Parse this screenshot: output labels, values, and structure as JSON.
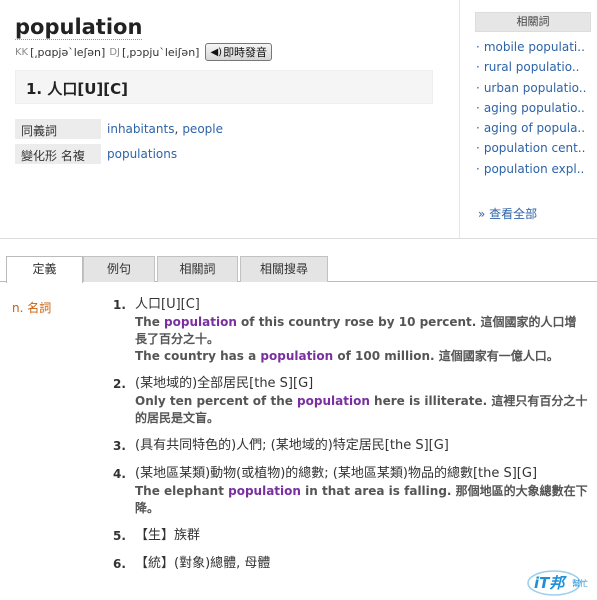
{
  "entry": {
    "word": "population",
    "kk_label": "KK",
    "kk_ipa": "[͵pɑpjə`leʃən]",
    "dj_label": "DJ",
    "dj_ipa": "[͵pɔpju`leiʃən]",
    "speak_label": "即時發音",
    "sense_heading": "1. 人口[U][C]"
  },
  "synonyms": {
    "label": "同義詞",
    "items": [
      "inhabitants",
      "people"
    ]
  },
  "inflections": {
    "label": "變化形 名複",
    "items": [
      "populations"
    ]
  },
  "sidebar": {
    "title": "相關詞",
    "items": [
      "mobile populati..",
      "rural populatio..",
      "urban populatio..",
      "aging populatio..",
      "aging of popula..",
      "population cent..",
      "population expl.."
    ],
    "see_all": "查看全部"
  },
  "tabs": [
    "定義",
    "例句",
    "相關詞",
    "相關搜尋"
  ],
  "definitions": {
    "part_of_speech": "n. 名詞",
    "senses": [
      {
        "num": "1.",
        "text": "人口[U][C]",
        "examples": [
          {
            "before": "The ",
            "keyword": "population",
            "after": " of this country rose by 10 percent. 這個國家的人口增長了百分之十。"
          },
          {
            "before": "The country has a ",
            "keyword": "population",
            "after": " of 100 million. 這個國家有一億人口。"
          }
        ]
      },
      {
        "num": "2.",
        "text": "(某地域的)全部居民[the S][G]",
        "examples": [
          {
            "before": "Only ten percent of the ",
            "keyword": "population",
            "after": " here is illiterate. 這裡只有百分之十的居民是文盲。"
          }
        ]
      },
      {
        "num": "3.",
        "text": "(具有共同特色的)人們; (某地域的)特定居民[the S][G]",
        "examples": []
      },
      {
        "num": "4.",
        "text": "(某地區某類)動物(或植物)的總數; (某地區某類)物品的總數[the S][G]",
        "examples": [
          {
            "before": "The elephant ",
            "keyword": "population",
            "after": " in that area is falling. 那個地區的大象總數在下降。"
          }
        ]
      },
      {
        "num": "5.",
        "text": "【生】族群",
        "examples": []
      },
      {
        "num": "6.",
        "text": "【統】(對象)總體, 母體",
        "examples": []
      }
    ]
  },
  "logo": {
    "text": "iT邦",
    "sub": "幫忙"
  },
  "colors": {
    "link": "#2d63a8",
    "keyword": "#7a2fa0",
    "pos": "#c95f0a",
    "logo": "#1f8fd6"
  }
}
